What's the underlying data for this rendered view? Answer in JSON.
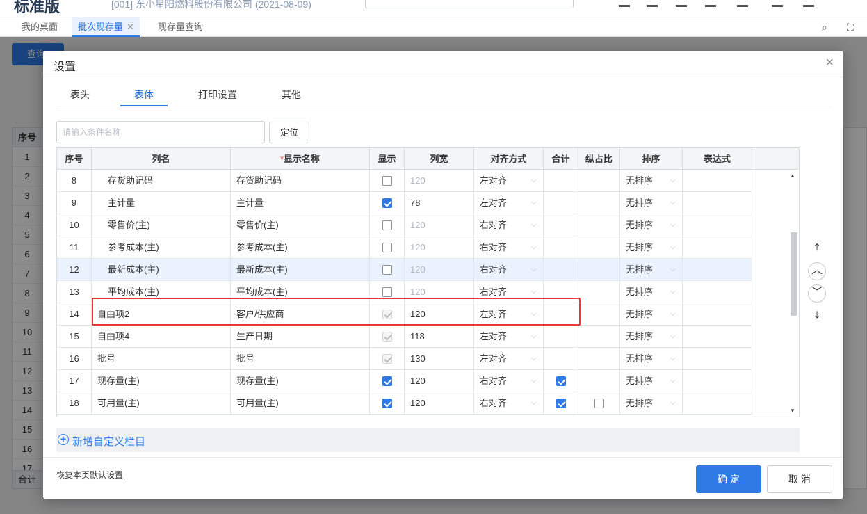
{
  "app": {
    "brand": "标准版",
    "company": "[001] 东小星阳燃料股份有限公司   (2021-08-09)",
    "tabs": [
      {
        "label": "我的桌面"
      },
      {
        "label": "批次现存量"
      },
      {
        "label": "现存量查询"
      }
    ],
    "query_button": "查询",
    "bg_grid": {
      "header": "序号",
      "rows": [
        "1",
        "2",
        "3",
        "4",
        "5",
        "6",
        "7",
        "8",
        "9",
        "10",
        "11",
        "12",
        "13",
        "14",
        "15",
        "16",
        "17"
      ],
      "sum_label": "合计"
    }
  },
  "dialog": {
    "title": "设置",
    "tabs": [
      {
        "label": "表头"
      },
      {
        "label": "表体"
      },
      {
        "label": "打印设置"
      },
      {
        "label": "其他"
      }
    ],
    "active_tab": "表体",
    "search": {
      "placeholder": "请输入条件名称",
      "value": ""
    },
    "locate_button": "定位",
    "columns": [
      "序号",
      "列名",
      "显示名称",
      "显示",
      "列宽",
      "对齐方式",
      "合计",
      "纵占比",
      "排序",
      "表达式"
    ],
    "required_mark": "*",
    "rows": [
      {
        "no": "8",
        "col": "存货助记码",
        "display": "存货助记码",
        "show": "off",
        "width": "120",
        "width_muted": true,
        "align": "左对齐",
        "sum": null,
        "ratio": null,
        "sort": "无排序",
        "indent": true
      },
      {
        "no": "9",
        "col": "主计量",
        "display": "主计量",
        "show": "on",
        "width": "78",
        "width_muted": false,
        "align": "左对齐",
        "sum": null,
        "ratio": null,
        "sort": "无排序",
        "indent": true
      },
      {
        "no": "10",
        "col": "零售价(主)",
        "display": "零售价(主)",
        "show": "off",
        "width": "120",
        "width_muted": true,
        "align": "右对齐",
        "sum": null,
        "ratio": null,
        "sort": "无排序",
        "indent": true
      },
      {
        "no": "11",
        "col": "参考成本(主)",
        "display": "参考成本(主)",
        "show": "off",
        "width": "120",
        "width_muted": true,
        "align": "右对齐",
        "sum": null,
        "ratio": null,
        "sort": "无排序",
        "indent": true
      },
      {
        "no": "12",
        "col": "最新成本(主)",
        "display": "最新成本(主)",
        "show": "off",
        "width": "120",
        "width_muted": true,
        "align": "右对齐",
        "sum": null,
        "ratio": null,
        "sort": "无排序",
        "indent": true,
        "highlight": true
      },
      {
        "no": "13",
        "col": "平均成本(主)",
        "display": "平均成本(主)",
        "show": "off",
        "width": "120",
        "width_muted": true,
        "align": "右对齐",
        "sum": null,
        "ratio": null,
        "sort": "无排序",
        "indent": true
      },
      {
        "no": "14",
        "col": "自由项2",
        "display": "客户/供应商",
        "show": "disabled",
        "width": "120",
        "width_muted": false,
        "align": "左对齐",
        "sum": null,
        "ratio": null,
        "sort": "无排序",
        "indent": false
      },
      {
        "no": "15",
        "col": "自由项4",
        "display": "生产日期",
        "show": "disabled",
        "width": "118",
        "width_muted": false,
        "align": "左对齐",
        "sum": null,
        "ratio": null,
        "sort": "无排序",
        "indent": false
      },
      {
        "no": "16",
        "col": "批号",
        "display": "批号",
        "show": "disabled",
        "width": "130",
        "width_muted": false,
        "align": "左对齐",
        "sum": null,
        "ratio": null,
        "sort": "无排序",
        "indent": false
      },
      {
        "no": "17",
        "col": "现存量(主)",
        "display": "现存量(主)",
        "show": "on",
        "width": "120",
        "width_muted": false,
        "align": "右对齐",
        "sum": "on",
        "ratio": null,
        "sort": "无排序",
        "indent": false
      },
      {
        "no": "18",
        "col": "可用量(主)",
        "display": "可用量(主)",
        "show": "on",
        "width": "120",
        "width_muted": false,
        "align": "右对齐",
        "sum": "on",
        "ratio": "off",
        "sort": "无排序",
        "indent": false
      }
    ],
    "add_custom": "新增自定义栏目",
    "restore_default": "恢复本页默认设置",
    "ok_button": "确 定",
    "cancel_button": "取 消",
    "colors": {
      "accent": "#2f7be6",
      "highlight_border": "#e53935"
    }
  }
}
